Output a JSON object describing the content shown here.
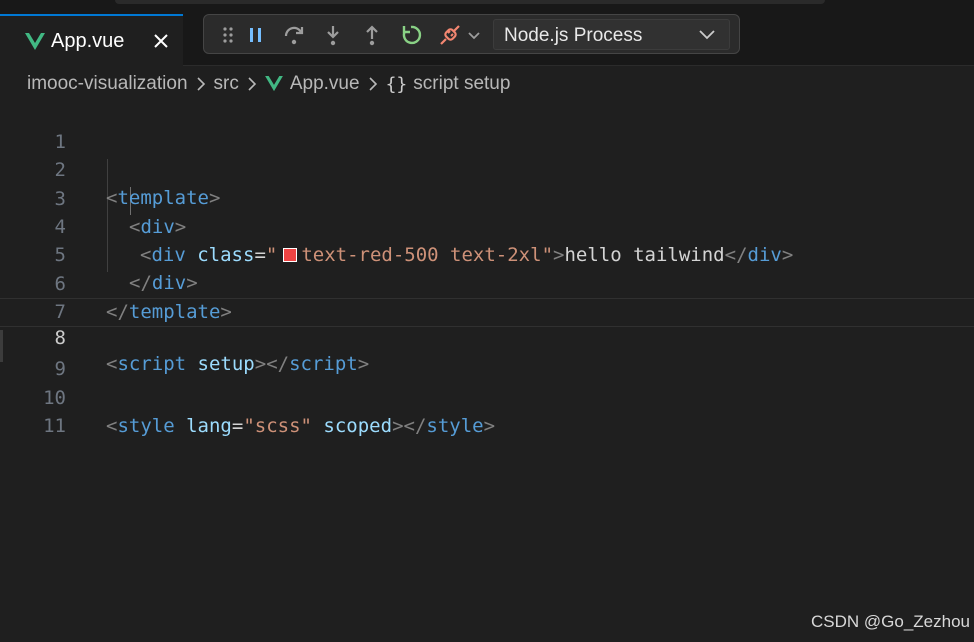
{
  "tab": {
    "label": "App.vue",
    "icon": "vue-icon",
    "close_icon": "close-icon"
  },
  "debug_toolbar": {
    "buttons": [
      "drag-handle-icon",
      "pause-icon",
      "step-over-icon",
      "step-into-icon",
      "step-out-icon",
      "restart-icon",
      "disconnect-icon",
      "chevron-down-icon"
    ],
    "process_select": "Node.js Process"
  },
  "breadcrumb": {
    "items": [
      "imooc-visualization",
      "src",
      "App.vue",
      "script setup"
    ],
    "braces": "{}"
  },
  "editor": {
    "active_line": 8,
    "lines": [
      {
        "n": "1"
      },
      {
        "n": "2",
        "p1": "<",
        "tag": "template",
        "p2": ">"
      },
      {
        "n": "3",
        "p1": "<",
        "tag": "div",
        "p2": ">"
      },
      {
        "n": "4",
        "p1": "<",
        "tag": "div",
        "attr": "class",
        "eq": "=",
        "q1": "\"",
        "cls": "text-red-500 text-2xl",
        "q2": "\"",
        "p2": ">",
        "text": "hello tailwind",
        "p3": "</",
        "tag2": "div",
        "p4": ">"
      },
      {
        "n": "5",
        "p1": "</",
        "tag": "div",
        "p2": ">"
      },
      {
        "n": "6",
        "p1": "</",
        "tag": "template",
        "p2": ">"
      },
      {
        "n": "7"
      },
      {
        "n": "8",
        "p1": "<",
        "tag": "script",
        "attr": "setup",
        "p2": "></",
        "tag2": "script",
        "p3": ">"
      },
      {
        "n": "9"
      },
      {
        "n": "10",
        "p1": "<",
        "tag": "style",
        "attr": "lang",
        "eq": "=",
        "str": "\"scss\"",
        "attr2": "scoped",
        "p2": "></",
        "tag2": "style",
        "p3": ">"
      },
      {
        "n": "11"
      }
    ],
    "color_swatch": "#ef4444"
  },
  "watermark": "CSDN @Go_Zezhou",
  "colors": {
    "tag": "#569cd6",
    "attr": "#9cdcfe",
    "string": "#ce9178",
    "punct": "#808080",
    "accent": "#0078d4"
  }
}
